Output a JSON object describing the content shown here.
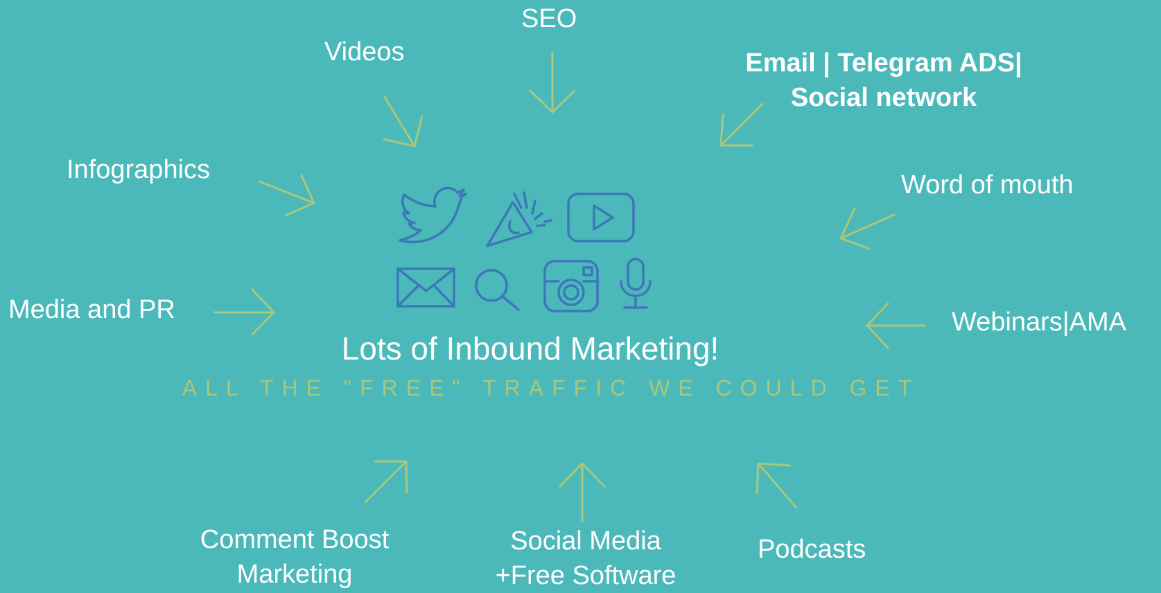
{
  "center": {
    "title": "Lots of Inbound Marketing!",
    "subtitle": "ALL THE \"FREE\" TRAFFIC WE COULD GET"
  },
  "channels": {
    "seo": "SEO",
    "videos": "Videos",
    "email_line1": "Email | Telegram ADS|",
    "email_line2": "Social network",
    "infographics": "Infographics",
    "word_of_mouth": "Word of mouth",
    "media_pr": "Media and PR",
    "webinars": "Webinars|AMA",
    "comment_line1": "Comment Boost",
    "comment_line2": "Marketing",
    "social_line1": "Social Media",
    "social_line2": "+Free Software",
    "podcasts": "Podcasts"
  },
  "icons": [
    "twitter-bird-icon",
    "megaphone-icon",
    "video-play-icon",
    "envelope-icon",
    "magnifier-icon",
    "instagram-camera-icon",
    "microphone-icon"
  ],
  "colors": {
    "background": "#4bb9ba",
    "arrow": "#a9c77a",
    "icon": "#3c78b8",
    "text": "#ffffff",
    "subtitle": "#a9c77a"
  }
}
